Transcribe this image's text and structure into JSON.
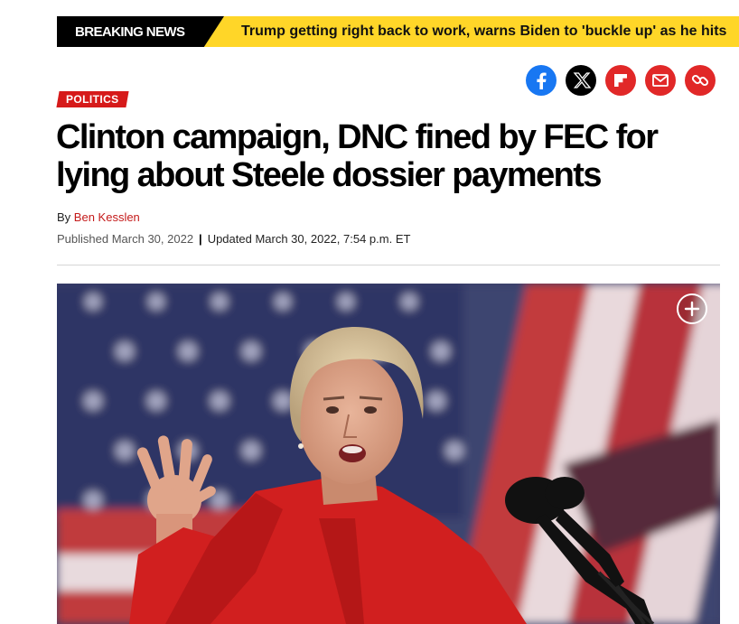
{
  "breaking": {
    "label": "BREAKING NEWS",
    "text": "Trump getting right back to work, warns Biden to 'buckle up' as he hits"
  },
  "share": {
    "icons": [
      "facebook-icon",
      "x-icon",
      "flipboard-icon",
      "email-icon",
      "link-icon"
    ]
  },
  "article": {
    "category": "POLITICS",
    "headline": "Clinton campaign, DNC fined by FEC for lying about Steele dossier payments",
    "by_prefix": "By",
    "author": "Ben Kesslen",
    "published": "Published March 30, 2022",
    "separator": "|",
    "updated": "Updated March 30, 2022, 7:54 p.m. ET"
  },
  "colors": {
    "accent": "#d61a1a",
    "breaking_bg": "#ffd628",
    "facebook": "#1877f2"
  },
  "hero": {
    "expand_icon": "plus-icon"
  }
}
